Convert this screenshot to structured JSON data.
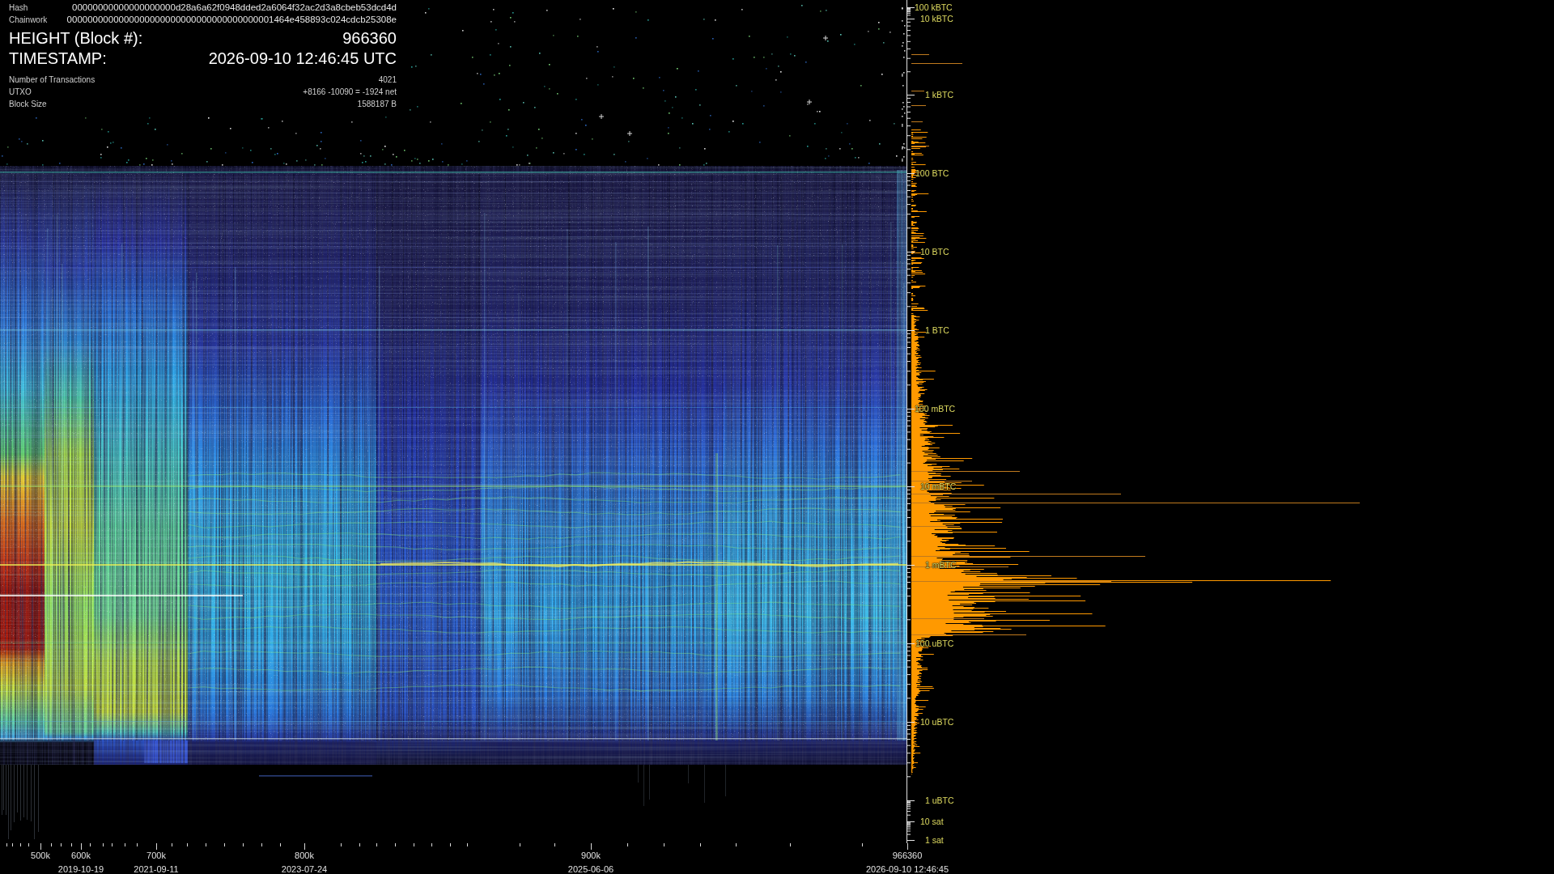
{
  "info_panel": {
    "rows": [
      {
        "kind": "code",
        "label": "Hash",
        "value": "00000000000000000000d28a6a62f0948dded2a6064f32ac2d3a8cbeb53dcd4d"
      },
      {
        "kind": "code",
        "label": "Chainwork",
        "value": "0000000000000000000000000000000000000001464e458893c024cdcb25308e"
      },
      {
        "kind": "headline",
        "label": "HEIGHT (Block #):",
        "value": "966360"
      },
      {
        "kind": "headline",
        "label": "TIMESTAMP:",
        "value": "2026-09-10 12:46:45 UTC"
      },
      {
        "kind": "stat",
        "label": "Number of Transactions",
        "value": "4021"
      },
      {
        "kind": "stat",
        "label": "UTXO",
        "value": "+8166 -10090 = -1924 net"
      },
      {
        "kind": "stat",
        "label": "Block Size",
        "value": "1588187 B"
      }
    ]
  },
  "amount_axis": {
    "labels": [
      "100 kBTC",
      "10 kBTC",
      "1 kBTC",
      "100 BTC",
      "10 BTC",
      "1 BTC",
      "100 mBTC",
      "10 mBTC",
      "1 mBTC",
      "100 uBTC",
      "10 uBTC",
      "1 uBTC",
      "10 sat",
      "1 sat"
    ]
  },
  "height_axis": {
    "ticks": [
      {
        "label": "500k"
      },
      {
        "label": "600k",
        "date": "2019-10-19"
      },
      {
        "label": "700k",
        "date": "2021-09-11"
      },
      {
        "label": "800k",
        "date": "2023-07-24"
      },
      {
        "label": "900k",
        "date": "2025-06-06"
      },
      {
        "label": "966360",
        "date": "2026-09-10 12:46:45"
      }
    ]
  }
}
